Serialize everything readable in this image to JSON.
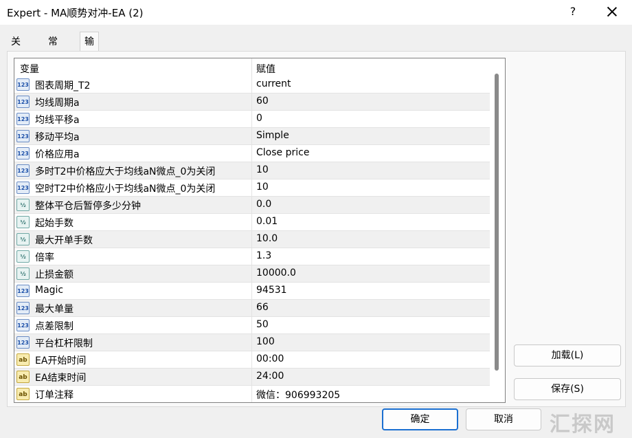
{
  "window": {
    "title": "Expert - MA顺势对冲-EA (2)",
    "help": "?"
  },
  "tabs": [
    {
      "label": "关于"
    },
    {
      "label": "常用"
    },
    {
      "label": "输入参数"
    }
  ],
  "grid": {
    "col_variable": "变量",
    "col_value": "赋值",
    "rows": [
      {
        "icon": "int",
        "name": "图表周期_T2",
        "value": "current"
      },
      {
        "icon": "int",
        "name": "均线周期a",
        "value": "60"
      },
      {
        "icon": "int",
        "name": "均线平移a",
        "value": "0"
      },
      {
        "icon": "int",
        "name": "移动平均a",
        "value": "Simple"
      },
      {
        "icon": "int",
        "name": "价格应用a",
        "value": "Close price"
      },
      {
        "icon": "int",
        "name": "多时T2中价格应大于均线aN微点_0为关闭",
        "value": "10"
      },
      {
        "icon": "int",
        "name": "空时T2中价格应小于均线aN微点_0为关闭",
        "value": "10"
      },
      {
        "icon": "dbl",
        "name": "整体平仓后暂停多少分钟",
        "value": "0.0"
      },
      {
        "icon": "dbl",
        "name": "起始手数",
        "value": "0.01"
      },
      {
        "icon": "dbl",
        "name": "最大开单手数",
        "value": "10.0"
      },
      {
        "icon": "dbl",
        "name": "倍率",
        "value": "1.3"
      },
      {
        "icon": "dbl",
        "name": "止损金额",
        "value": "10000.0"
      },
      {
        "icon": "int",
        "name": "Magic",
        "value": "94531"
      },
      {
        "icon": "int",
        "name": "最大单量",
        "value": "66"
      },
      {
        "icon": "int",
        "name": "点差限制",
        "value": "50"
      },
      {
        "icon": "int",
        "name": "平台杠杆限制",
        "value": "100"
      },
      {
        "icon": "str",
        "name": "EA开始时间",
        "value": "00:00"
      },
      {
        "icon": "str",
        "name": "EA结束时间",
        "value": "24:00"
      },
      {
        "icon": "str",
        "name": "订单注释",
        "value": "微信：906993205"
      }
    ]
  },
  "icon_glyphs": {
    "int": "123",
    "dbl": "½",
    "str": "ab"
  },
  "buttons": {
    "load": "加载(L)",
    "save": "保存(S)",
    "ok": "确定",
    "cancel": "取消"
  },
  "watermark": "汇探网"
}
